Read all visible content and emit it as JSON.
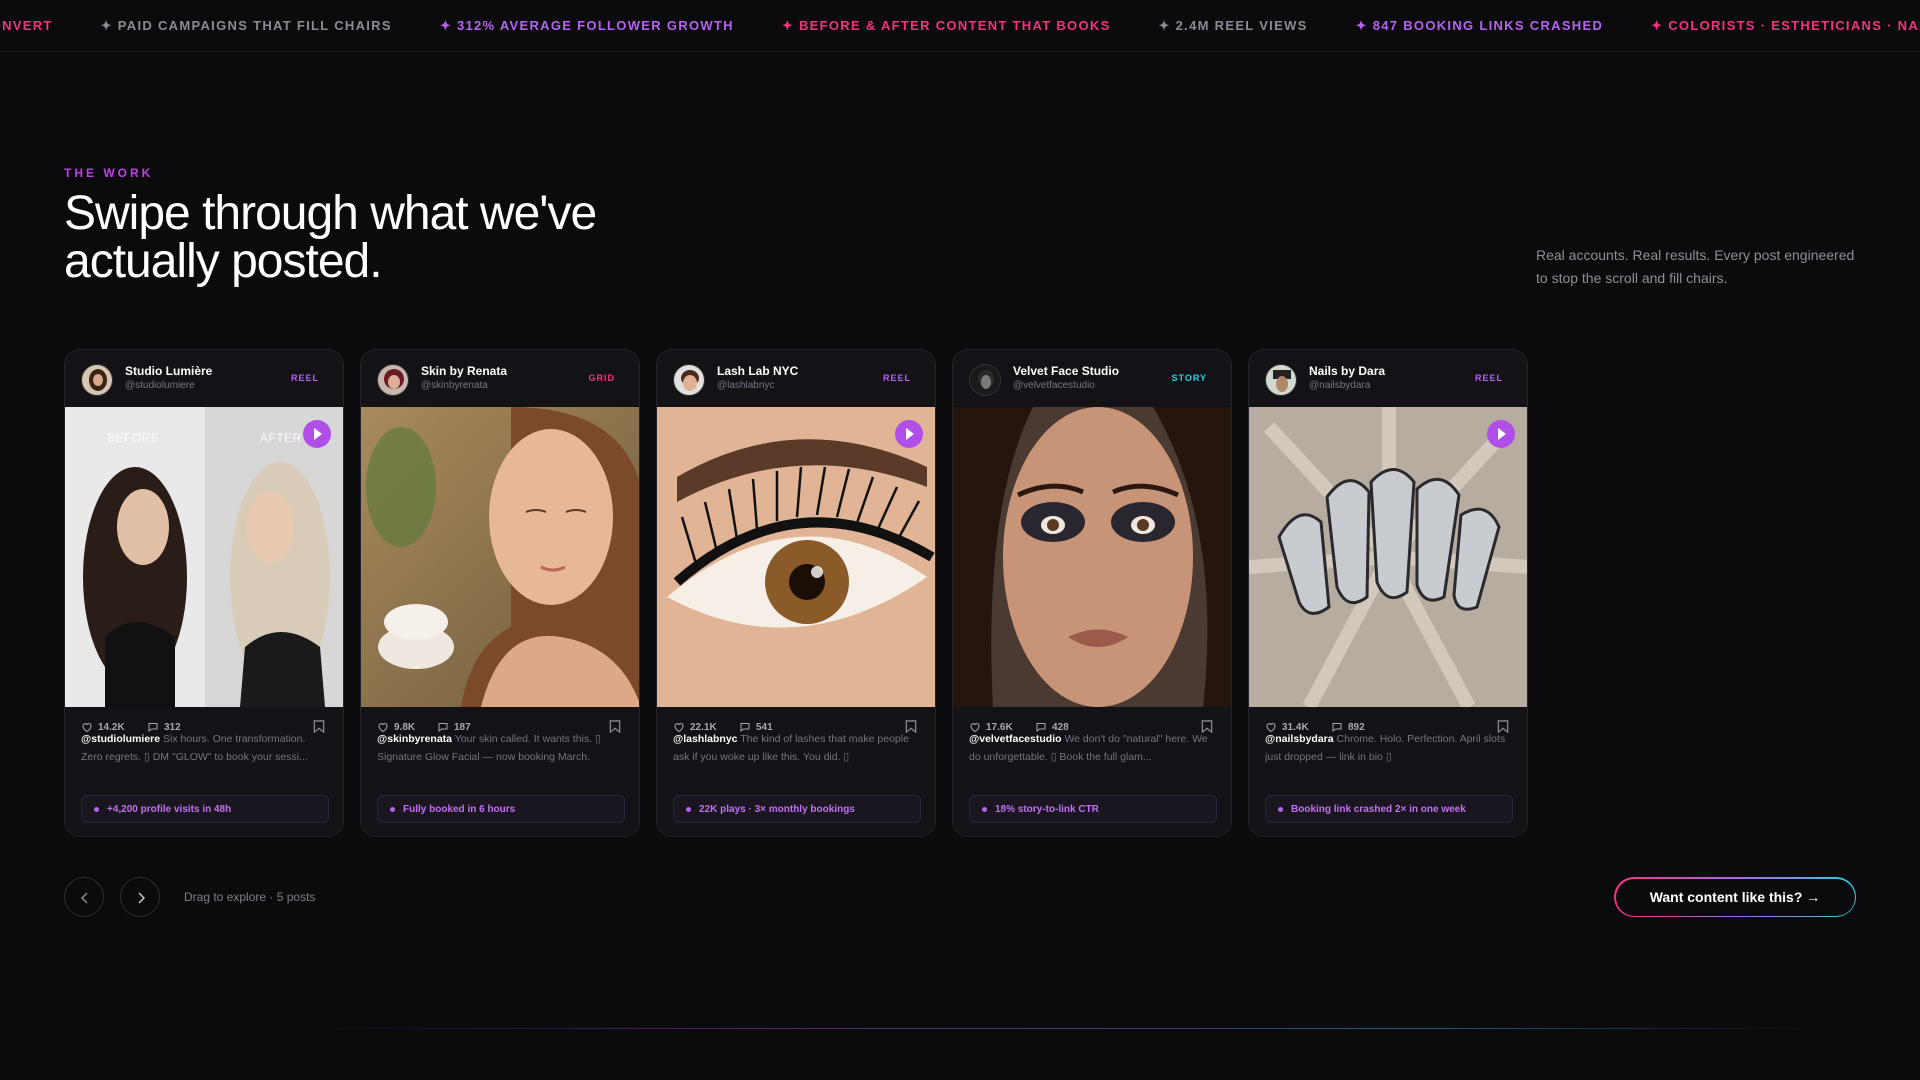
{
  "ticker": [
    {
      "text": "CONVERT",
      "tone": "pink"
    },
    {
      "text": "✦ PAID CAMPAIGNS THAT FILL CHAIRS",
      "tone": "gray"
    },
    {
      "text": "✦ 312% AVERAGE FOLLOWER GROWTH",
      "tone": "purple"
    },
    {
      "text": "✦ BEFORE & AFTER CONTENT THAT BOOKS",
      "tone": "pink"
    },
    {
      "text": "✦ 2.4M REEL VIEWS",
      "tone": "gray"
    },
    {
      "text": "✦ 847 BOOKING LINKS CRASHED",
      "tone": "purple"
    },
    {
      "text": "✦ COLORISTS · ESTHETICIANS · NAIL ARTISTS · BRO",
      "tone": "pink"
    }
  ],
  "section": {
    "eyebrow": "THE WORK",
    "title": "Swipe through what we've actually posted.",
    "description": "Real accounts. Real results. Every post engineered to stop the scroll and fill chairs."
  },
  "cards": [
    {
      "account": "Studio Lumière",
      "handle": "@studiolumiere",
      "tag": "REEL",
      "tag_tone": "reel",
      "likes": "14.2K",
      "comments": "312",
      "caption_handle": "@studiolumiere",
      "caption": " Six hours. One transformation. Zero regrets. ▯ DM \"GLOW\" to book your sessi...",
      "result": "+4,200 profile visits in 48h",
      "before_label": "BEFORE",
      "after_label": "AFTER"
    },
    {
      "account": "Skin by Renata",
      "handle": "@skinbyrenata",
      "tag": "GRID",
      "tag_tone": "grid",
      "likes": "9.8K",
      "comments": "187",
      "caption_handle": "@skinbyrenata",
      "caption": " Your skin called. It wants this. ▯ Signature Glow Facial — now booking March.",
      "result": "Fully booked in 6 hours"
    },
    {
      "account": "Lash Lab NYC",
      "handle": "@lashlabnyc",
      "tag": "REEL",
      "tag_tone": "reel",
      "likes": "22.1K",
      "comments": "541",
      "caption_handle": "@lashlabnyc",
      "caption": " The kind of lashes that make people ask if you woke up like this. You did. ▯",
      "result": "22K plays · 3× monthly bookings"
    },
    {
      "account": "Velvet Face Studio",
      "handle": "@velvetfacestudio",
      "tag": "STORY",
      "tag_tone": "story",
      "likes": "17.6K",
      "comments": "428",
      "caption_handle": "@velvetfacestudio",
      "caption": " We don't do \"natural\" here. We do unforgettable. ▯ Book the full glam...",
      "result": "18% story-to-link CTR"
    },
    {
      "account": "Nails by Dara",
      "handle": "@nailsbydara",
      "tag": "REEL",
      "tag_tone": "reel",
      "likes": "31.4K",
      "comments": "892",
      "caption_handle": "@nailsbydara",
      "caption": " Chrome. Holo. Perfection. April slots just dropped — link in bio ▯",
      "result": "Booking link crashed 2× in one week"
    }
  ],
  "nav": {
    "drag_text": "Drag to explore · 5 posts",
    "cta_label": "Want content like this? →"
  },
  "colors": {
    "accent_purple": "#b563f0",
    "accent_pink": "#f0347f",
    "accent_cyan": "#1fd6e0",
    "background": "#0b0a0d"
  }
}
